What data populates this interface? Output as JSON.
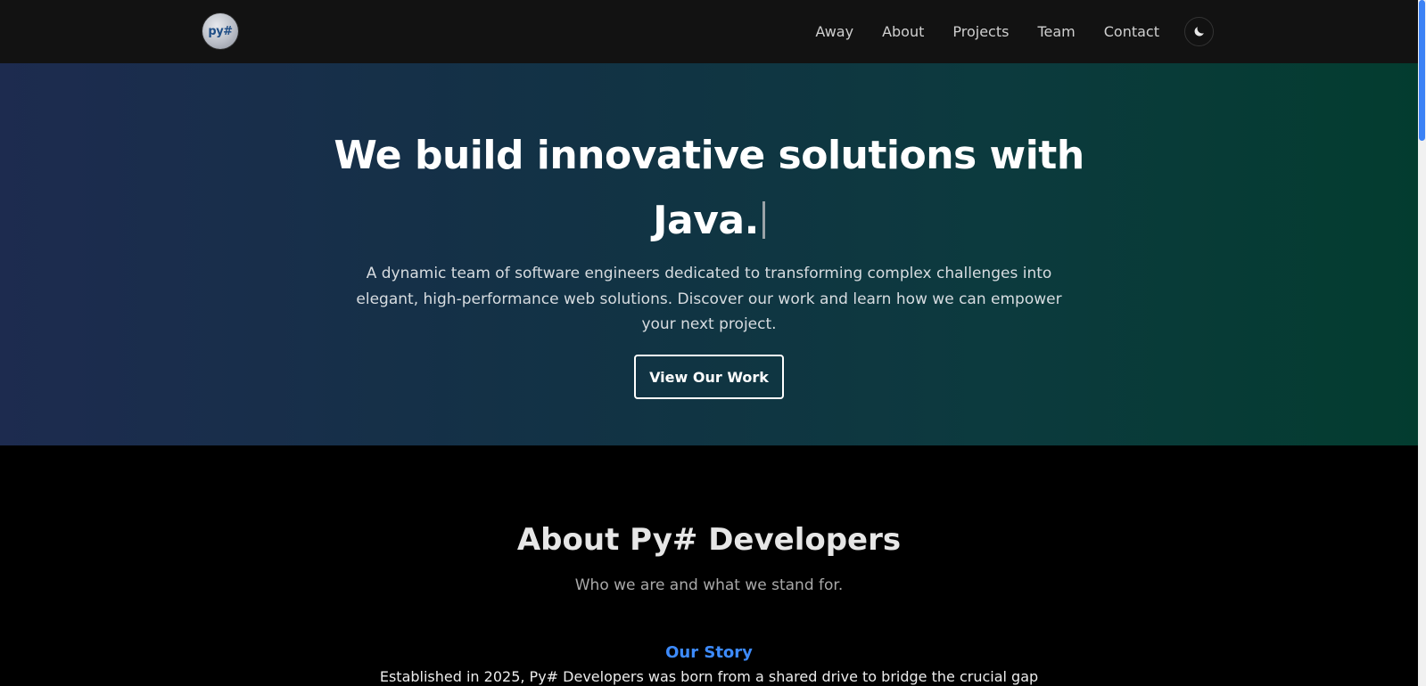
{
  "navbar": {
    "logo_text": "py#",
    "links": [
      "Away",
      "About",
      "Projects",
      "Team",
      "Contact"
    ],
    "theme_toggle_icon": "moon-icon"
  },
  "hero": {
    "title_line1": "We build innovative solutions with",
    "title_word": "Java.",
    "description": "A dynamic team of software engineers dedicated to transforming complex challenges into elegant, high-performance web solutions. Discover our work and learn how we can empower your next project.",
    "cta_label": "View Our Work"
  },
  "about": {
    "title": "About Py# Developers",
    "subtitle": "Who we are and what we stand for.",
    "story_heading": "Our Story",
    "story_text": "Established in 2025, Py# Developers was born from a shared drive to bridge the crucial gap"
  },
  "colors": {
    "navbar_bg": "#121212",
    "hero_gradient_start": "#1d2b4f",
    "hero_gradient_end": "#033c2f",
    "accent": "#3d8bfd",
    "page_bg": "#000000"
  }
}
